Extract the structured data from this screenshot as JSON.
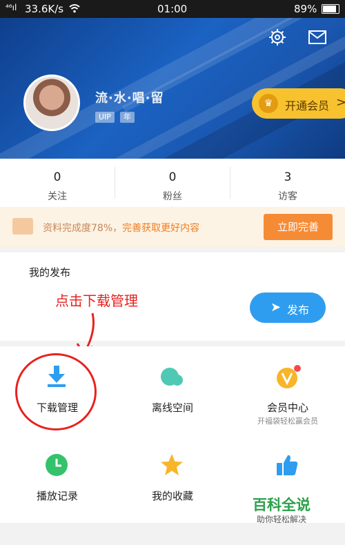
{
  "status_bar": {
    "signal": "⁴⁶ıl",
    "speed": "33.6K/s",
    "time": "01:00",
    "battery": "89%"
  },
  "profile": {
    "username": "流·水·唱·留",
    "badge_vip": "UIP",
    "badge_year": "年",
    "vip_button": "开通会员",
    "vip_chevron": ">"
  },
  "stats": [
    {
      "value": "0",
      "label": "关注"
    },
    {
      "value": "0",
      "label": "粉丝"
    },
    {
      "value": "3",
      "label": "访客"
    }
  ],
  "banner": {
    "text_prefix": "资料完成度78%，",
    "text_highlight": "完善获取更好内容",
    "button": "立即完善"
  },
  "my_post": {
    "title": "我的发布",
    "publish_button": "发布",
    "annotation": "点击下载管理"
  },
  "grid": [
    {
      "label": "下载管理",
      "icon": "download-icon",
      "sub": ""
    },
    {
      "label": "离线空间",
      "icon": "cloud-icon",
      "sub": ""
    },
    {
      "label": "会员中心",
      "icon": "vip-icon",
      "sub": "开福袋轻松赢会员"
    },
    {
      "label": "播放记录",
      "icon": "clock-icon",
      "sub": ""
    },
    {
      "label": "我的收藏",
      "icon": "star-icon",
      "sub": ""
    },
    {
      "label": "",
      "icon": "thumbs-up-icon",
      "sub": ""
    }
  ],
  "watermark": {
    "title": "百科全说",
    "subtitle": "助你轻松解决"
  },
  "colors": {
    "header": "#1b62c2",
    "accent_orange": "#f68b35",
    "publish_blue": "#2e9df0",
    "annotation_red": "#e8211e",
    "vip_gold": "#f7c22e"
  }
}
